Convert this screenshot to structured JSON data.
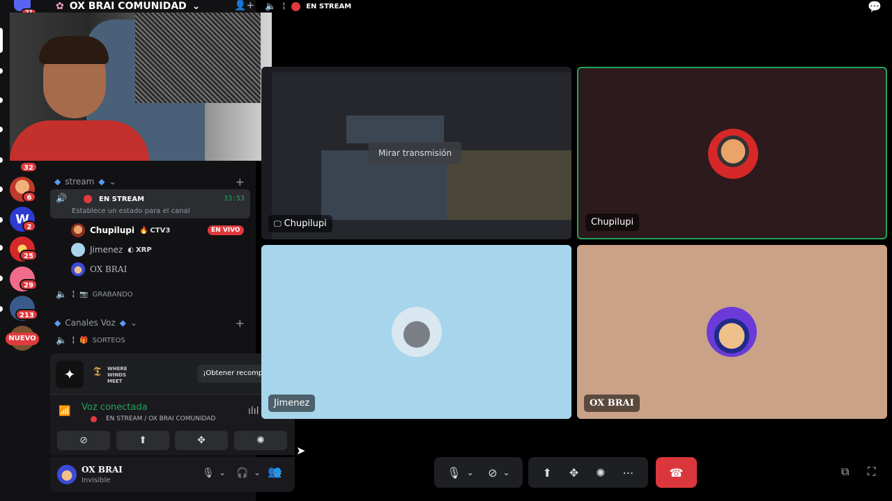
{
  "server": {
    "name": "OX BRAI COMUNIDAD",
    "unread_top": "21"
  },
  "rail": {
    "badges": [
      "32",
      "6",
      "2",
      "25",
      "29",
      "213"
    ],
    "new_label": "NUEVO"
  },
  "sidebar": {
    "section_stream": "stream",
    "channel_stream": {
      "name": "EN STREAM",
      "timer": "33:53",
      "status_hint": "Establece un estado para el canal"
    },
    "users": [
      {
        "name": "Chupilupi",
        "activity": "CTV3",
        "badge": "EN VIVO"
      },
      {
        "name": "Jimenez",
        "activity": "XRP"
      },
      {
        "name": "OX BRAI"
      }
    ],
    "channel_recording": "GRABANDO",
    "section_voice": "Canales Voz",
    "channel_giveaways": "SORTEOS"
  },
  "promo": {
    "game": "WHERE WINDS MEET",
    "button": "¡Obtener recompensa!"
  },
  "voice": {
    "status": "Voz conectada",
    "location": "EN STREAM / OX BRAI COMUNIDAD"
  },
  "user": {
    "name": "OX BRAI",
    "status": "Invisible"
  },
  "topbar": {
    "channel": "EN STREAM"
  },
  "tiles": {
    "stream_owner": "Chupilupi",
    "watch_button": "Mirar transmisión",
    "user_chupilupi": "Chupilupi",
    "user_jimenez": "Jimenez",
    "user_oxbrai": "OX BRAI"
  },
  "colors": {
    "accent_green": "#23a55a",
    "danger": "#da373c",
    "live": "#e03a3e"
  }
}
